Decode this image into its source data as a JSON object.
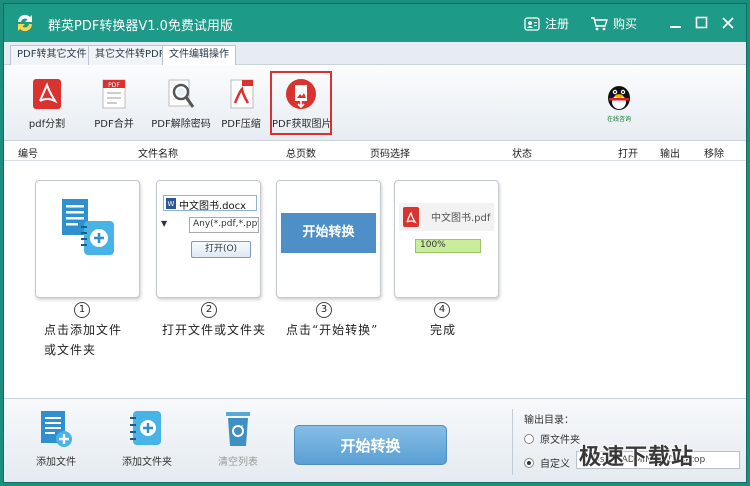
{
  "window": {
    "title": "群英PDF转换器V1.0免费试用版",
    "register_label": "注册",
    "buy_label": "购买"
  },
  "tabs": [
    {
      "label": "PDF转其它文件"
    },
    {
      "label": "其它文件转PDF"
    },
    {
      "label": "文件编辑操作",
      "active": true
    }
  ],
  "toolbar": {
    "items": [
      {
        "label": "pdf分割",
        "icon": "pdf-split-icon"
      },
      {
        "label": "PDF合并",
        "icon": "pdf-merge-icon"
      },
      {
        "label": "PDF解除密码",
        "icon": "pdf-unlock-icon"
      },
      {
        "label": "PDF压缩",
        "icon": "pdf-compress-icon"
      },
      {
        "label": "PDF获取图片",
        "icon": "pdf-extract-image-icon",
        "selected": true
      }
    ],
    "qq_label": "在线咨询"
  },
  "list_header": {
    "columns": [
      "编号",
      "文件名称",
      "总页数",
      "页码选择",
      "状态",
      "打开",
      "输出",
      "移除"
    ]
  },
  "guide": {
    "steps": [
      {
        "num": "1",
        "text_line1": "点击添加文件",
        "text_line2": "或文件夹"
      },
      {
        "num": "2",
        "text_line1": "打开文件或文件夹",
        "text_line2": ""
      },
      {
        "num": "3",
        "text_line1": "点击“开始转换”",
        "text_line2": ""
      },
      {
        "num": "4",
        "text_line1": "完成",
        "text_line2": ""
      }
    ],
    "dialog_file": "中文图书.docx",
    "dialog_filter": "Any(*.pdf,*.ppt,*",
    "dialog_open": "打开(O)",
    "convert_mini": "开始转换",
    "done_file": "中文图书.pdf",
    "done_progress": "100%",
    "done_progress_value": 1.0
  },
  "bottom": {
    "add_file": "添加文件",
    "add_folder": "添加文件夹",
    "clear_list": "清空列表",
    "start": "开始转换",
    "output_dir_label": "输出目录：",
    "option_source": "原文件夹",
    "option_custom": "自定义",
    "custom_path": "C:\\Users\\ADMIN~1\\Desktop",
    "watermark": "极速下载站"
  },
  "colors": {
    "titlebar": "#1d9a88",
    "accent_blue": "#5a9fd4",
    "selected_border": "#d9322f"
  }
}
